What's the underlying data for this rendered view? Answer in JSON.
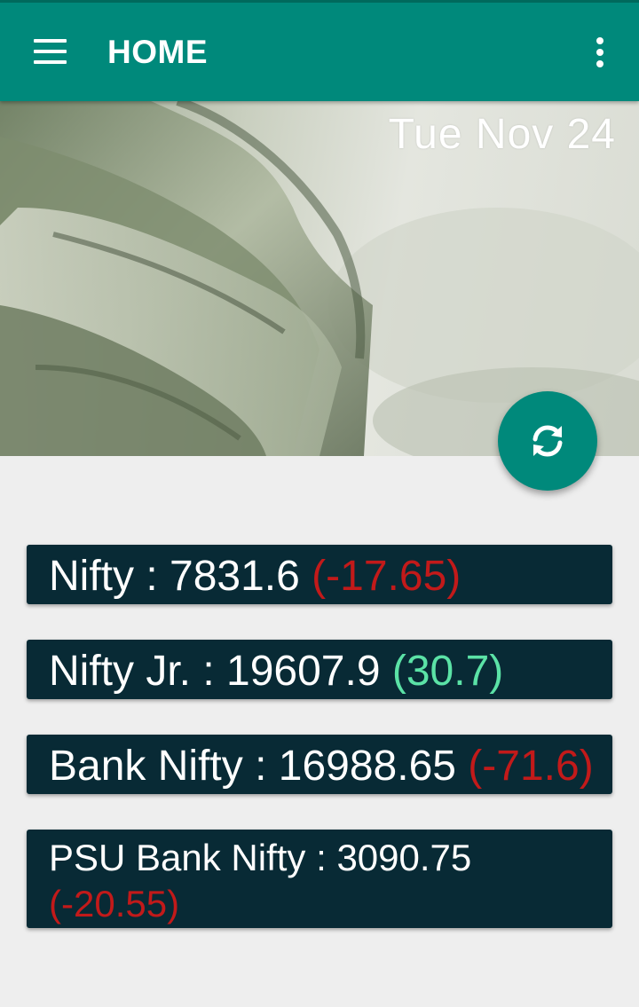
{
  "app_bar": {
    "title": "HOME",
    "menu_icon": "hamburger-menu-icon",
    "overflow_icon": "more-vertical-icon",
    "color": "#00897b"
  },
  "header": {
    "date": "Tue Nov 24",
    "image": "dollar-bills-banner"
  },
  "fab": {
    "icon": "refresh-icon"
  },
  "indices": [
    {
      "label": "Nifty : ",
      "value": "7831.6",
      "change": "(-17.65)",
      "direction": "down"
    },
    {
      "label": "Nifty Jr. : ",
      "value": "19607.9",
      "change": "(30.7)",
      "direction": "up"
    },
    {
      "label": "Bank Nifty : ",
      "value": "16988.65",
      "change": "(-71.6)",
      "direction": "down"
    },
    {
      "label": "PSU Bank Nifty : ",
      "value": "3090.75",
      "change": "(-20.55)",
      "direction": "down"
    }
  ],
  "colors": {
    "card_bg": "#082a35",
    "negative": "#c21a1a",
    "positive": "#5be2a6"
  }
}
